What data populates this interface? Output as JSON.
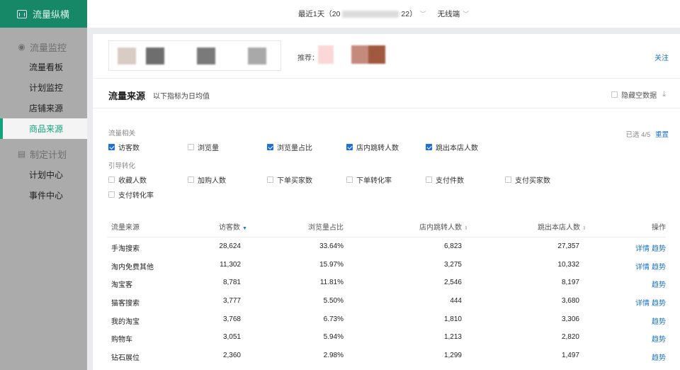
{
  "sidebar": {
    "logo": "流量纵横",
    "groups": [
      {
        "label": "流量监控",
        "icon": "eye-icon",
        "items": [
          "流量看板",
          "计划监控",
          "店铺来源",
          "商品来源"
        ]
      },
      {
        "label": "制定计划",
        "icon": "document-icon",
        "items": [
          "计划中心",
          "事件中心"
        ]
      }
    ],
    "active_item": "商品来源"
  },
  "topbar": {
    "date_prefix": "最近1天（20",
    "date_suffix": "22）",
    "device": "无线端"
  },
  "promo": {
    "recommend_label": "推荐：",
    "follow": "关注"
  },
  "section": {
    "title": "流量来源",
    "subtitle": "以下指标为日均值",
    "hide_empty": "隐藏空数据"
  },
  "filters": {
    "group1_label": "流量相关",
    "group2_label": "引导转化",
    "selected_text": "已选 4/5",
    "reset": "重置",
    "group1": [
      {
        "label": "访客数",
        "checked": true
      },
      {
        "label": "浏览量",
        "checked": false
      },
      {
        "label": "浏览量占比",
        "checked": true
      },
      {
        "label": "店内跳转人数",
        "checked": true
      },
      {
        "label": "跳出本店人数",
        "checked": true
      }
    ],
    "group2": [
      {
        "label": "收藏人数",
        "checked": false
      },
      {
        "label": "加购人数",
        "checked": false
      },
      {
        "label": "下单买家数",
        "checked": false
      },
      {
        "label": "下单转化率",
        "checked": false
      },
      {
        "label": "支付件数",
        "checked": false
      },
      {
        "label": "支付买家数",
        "checked": false
      },
      {
        "label": "支付转化率",
        "checked": false
      }
    ]
  },
  "table": {
    "headers": [
      "流量来源",
      "访客数",
      "浏览量占比",
      "店内跳转人数",
      "跳出本店人数",
      "操作"
    ],
    "rows": [
      {
        "source": "手淘搜索",
        "visitors": "28,624",
        "pv_ratio": "33.64%",
        "jump_in": "6,823",
        "bounce": "27,357",
        "ops": [
          "详情",
          "趋势"
        ]
      },
      {
        "source": "淘内免费其他",
        "visitors": "11,302",
        "pv_ratio": "15.97%",
        "jump_in": "3,275",
        "bounce": "10,332",
        "ops": [
          "详情",
          "趋势"
        ]
      },
      {
        "source": "淘宝客",
        "visitors": "8,781",
        "pv_ratio": "11.81%",
        "jump_in": "2,546",
        "bounce": "8,197",
        "ops": [
          "趋势"
        ]
      },
      {
        "source": "猫客搜索",
        "visitors": "3,777",
        "pv_ratio": "5.50%",
        "jump_in": "444",
        "bounce": "3,680",
        "ops": [
          "详情",
          "趋势"
        ]
      },
      {
        "source": "我的淘宝",
        "visitors": "3,768",
        "pv_ratio": "6.73%",
        "jump_in": "1,810",
        "bounce": "3,306",
        "ops": [
          "趋势"
        ]
      },
      {
        "source": "购物车",
        "visitors": "3,051",
        "pv_ratio": "5.94%",
        "jump_in": "1,213",
        "bounce": "2,820",
        "ops": [
          "趋势"
        ]
      },
      {
        "source": "钻石展位",
        "visitors": "2,360",
        "pv_ratio": "2.98%",
        "jump_in": "1,299",
        "bounce": "1,497",
        "ops": [
          "趋势"
        ]
      }
    ]
  },
  "colors": {
    "brand_green": "#168867",
    "active_green": "#12a37b",
    "link_blue": "#1a73c8",
    "checkbox_blue": "#1e6fd8"
  }
}
